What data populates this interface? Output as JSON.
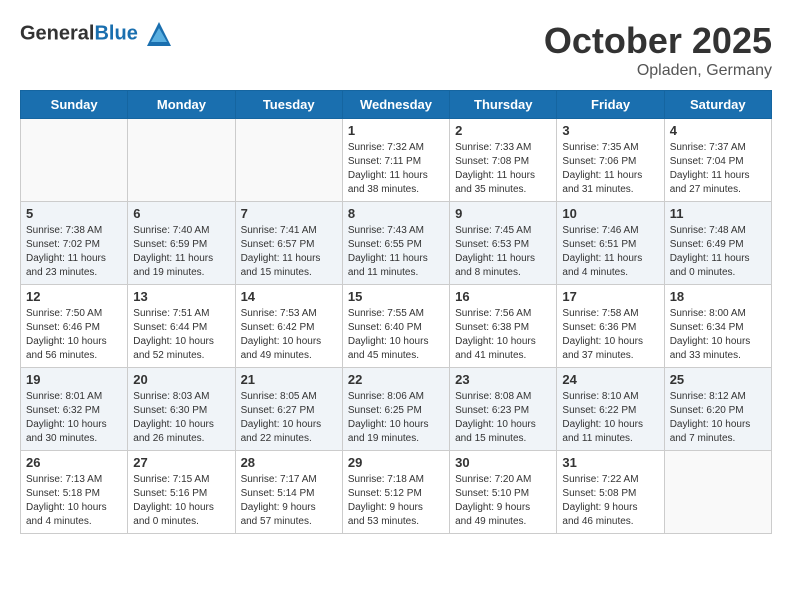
{
  "header": {
    "logo_general": "General",
    "logo_blue": "Blue",
    "month": "October 2025",
    "location": "Opladen, Germany"
  },
  "days_of_week": [
    "Sunday",
    "Monday",
    "Tuesday",
    "Wednesday",
    "Thursday",
    "Friday",
    "Saturday"
  ],
  "weeks": [
    [
      {
        "day": "",
        "info": ""
      },
      {
        "day": "",
        "info": ""
      },
      {
        "day": "",
        "info": ""
      },
      {
        "day": "1",
        "info": "Sunrise: 7:32 AM\nSunset: 7:11 PM\nDaylight: 11 hours\nand 38 minutes."
      },
      {
        "day": "2",
        "info": "Sunrise: 7:33 AM\nSunset: 7:08 PM\nDaylight: 11 hours\nand 35 minutes."
      },
      {
        "day": "3",
        "info": "Sunrise: 7:35 AM\nSunset: 7:06 PM\nDaylight: 11 hours\nand 31 minutes."
      },
      {
        "day": "4",
        "info": "Sunrise: 7:37 AM\nSunset: 7:04 PM\nDaylight: 11 hours\nand 27 minutes."
      }
    ],
    [
      {
        "day": "5",
        "info": "Sunrise: 7:38 AM\nSunset: 7:02 PM\nDaylight: 11 hours\nand 23 minutes."
      },
      {
        "day": "6",
        "info": "Sunrise: 7:40 AM\nSunset: 6:59 PM\nDaylight: 11 hours\nand 19 minutes."
      },
      {
        "day": "7",
        "info": "Sunrise: 7:41 AM\nSunset: 6:57 PM\nDaylight: 11 hours\nand 15 minutes."
      },
      {
        "day": "8",
        "info": "Sunrise: 7:43 AM\nSunset: 6:55 PM\nDaylight: 11 hours\nand 11 minutes."
      },
      {
        "day": "9",
        "info": "Sunrise: 7:45 AM\nSunset: 6:53 PM\nDaylight: 11 hours\nand 8 minutes."
      },
      {
        "day": "10",
        "info": "Sunrise: 7:46 AM\nSunset: 6:51 PM\nDaylight: 11 hours\nand 4 minutes."
      },
      {
        "day": "11",
        "info": "Sunrise: 7:48 AM\nSunset: 6:49 PM\nDaylight: 11 hours\nand 0 minutes."
      }
    ],
    [
      {
        "day": "12",
        "info": "Sunrise: 7:50 AM\nSunset: 6:46 PM\nDaylight: 10 hours\nand 56 minutes."
      },
      {
        "day": "13",
        "info": "Sunrise: 7:51 AM\nSunset: 6:44 PM\nDaylight: 10 hours\nand 52 minutes."
      },
      {
        "day": "14",
        "info": "Sunrise: 7:53 AM\nSunset: 6:42 PM\nDaylight: 10 hours\nand 49 minutes."
      },
      {
        "day": "15",
        "info": "Sunrise: 7:55 AM\nSunset: 6:40 PM\nDaylight: 10 hours\nand 45 minutes."
      },
      {
        "day": "16",
        "info": "Sunrise: 7:56 AM\nSunset: 6:38 PM\nDaylight: 10 hours\nand 41 minutes."
      },
      {
        "day": "17",
        "info": "Sunrise: 7:58 AM\nSunset: 6:36 PM\nDaylight: 10 hours\nand 37 minutes."
      },
      {
        "day": "18",
        "info": "Sunrise: 8:00 AM\nSunset: 6:34 PM\nDaylight: 10 hours\nand 33 minutes."
      }
    ],
    [
      {
        "day": "19",
        "info": "Sunrise: 8:01 AM\nSunset: 6:32 PM\nDaylight: 10 hours\nand 30 minutes."
      },
      {
        "day": "20",
        "info": "Sunrise: 8:03 AM\nSunset: 6:30 PM\nDaylight: 10 hours\nand 26 minutes."
      },
      {
        "day": "21",
        "info": "Sunrise: 8:05 AM\nSunset: 6:27 PM\nDaylight: 10 hours\nand 22 minutes."
      },
      {
        "day": "22",
        "info": "Sunrise: 8:06 AM\nSunset: 6:25 PM\nDaylight: 10 hours\nand 19 minutes."
      },
      {
        "day": "23",
        "info": "Sunrise: 8:08 AM\nSunset: 6:23 PM\nDaylight: 10 hours\nand 15 minutes."
      },
      {
        "day": "24",
        "info": "Sunrise: 8:10 AM\nSunset: 6:22 PM\nDaylight: 10 hours\nand 11 minutes."
      },
      {
        "day": "25",
        "info": "Sunrise: 8:12 AM\nSunset: 6:20 PM\nDaylight: 10 hours\nand 7 minutes."
      }
    ],
    [
      {
        "day": "26",
        "info": "Sunrise: 7:13 AM\nSunset: 5:18 PM\nDaylight: 10 hours\nand 4 minutes."
      },
      {
        "day": "27",
        "info": "Sunrise: 7:15 AM\nSunset: 5:16 PM\nDaylight: 10 hours\nand 0 minutes."
      },
      {
        "day": "28",
        "info": "Sunrise: 7:17 AM\nSunset: 5:14 PM\nDaylight: 9 hours\nand 57 minutes."
      },
      {
        "day": "29",
        "info": "Sunrise: 7:18 AM\nSunset: 5:12 PM\nDaylight: 9 hours\nand 53 minutes."
      },
      {
        "day": "30",
        "info": "Sunrise: 7:20 AM\nSunset: 5:10 PM\nDaylight: 9 hours\nand 49 minutes."
      },
      {
        "day": "31",
        "info": "Sunrise: 7:22 AM\nSunset: 5:08 PM\nDaylight: 9 hours\nand 46 minutes."
      },
      {
        "day": "",
        "info": ""
      }
    ]
  ]
}
